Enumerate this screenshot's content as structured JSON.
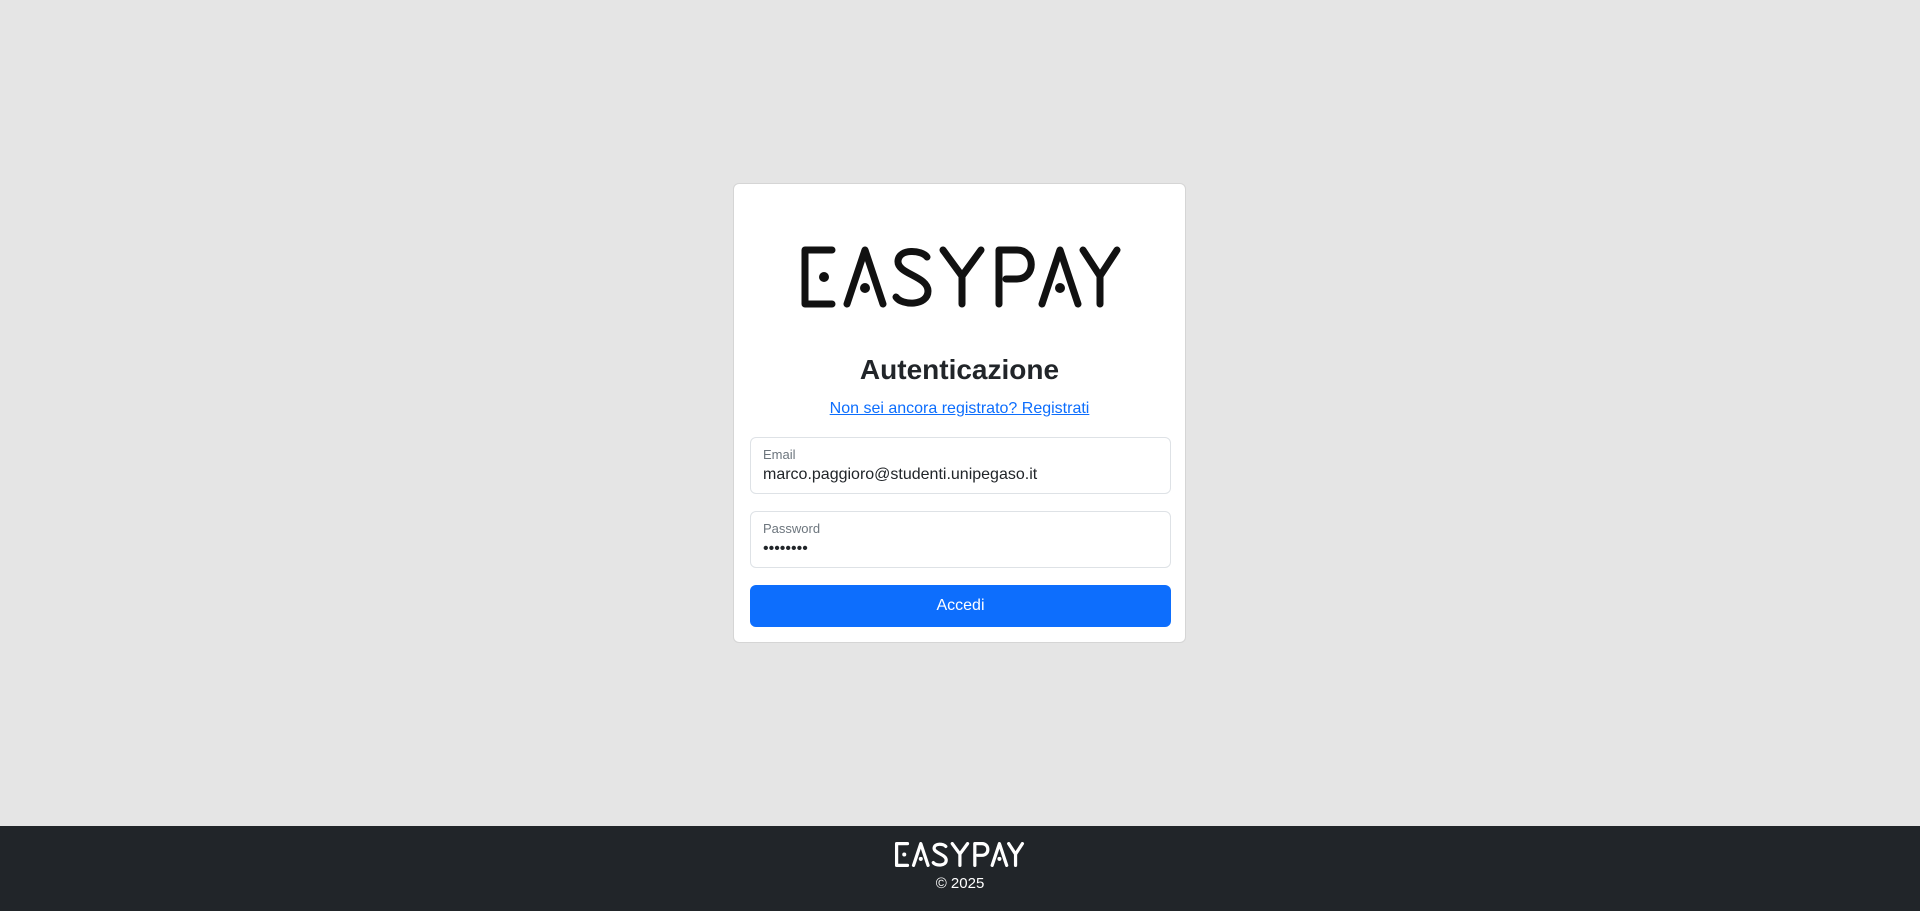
{
  "brand": {
    "logo_text": "EASYPAY"
  },
  "login": {
    "title": "Autenticazione",
    "register_link": "Non sei ancora registrato? Registrati",
    "email_label": "Email",
    "email_value": "marco.paggioro@studenti.unipegaso.it",
    "password_label": "Password",
    "password_value": "12345678",
    "submit_label": "Accedi"
  },
  "footer": {
    "logo_text": "EASYPAY",
    "copyright": "© 2025"
  },
  "colors": {
    "primary": "#0d6efd",
    "background": "#e5e5e5",
    "footer_bg": "#212529"
  }
}
